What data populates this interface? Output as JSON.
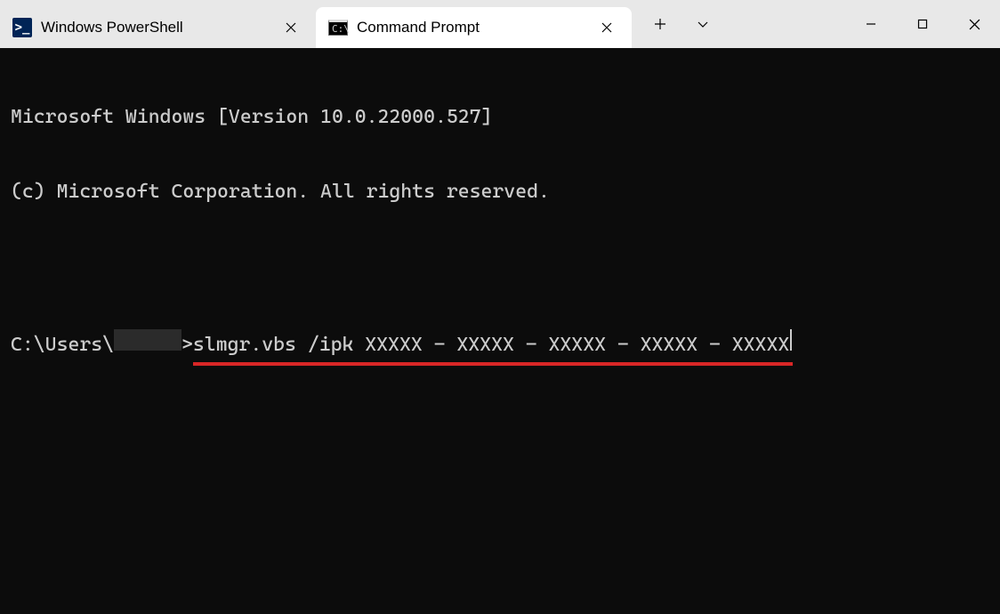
{
  "tabs": [
    {
      "title": "Windows PowerShell",
      "icon": "powershell-icon",
      "active": false
    },
    {
      "title": "Command Prompt",
      "icon": "cmd-icon",
      "active": true
    }
  ],
  "terminal": {
    "banner_line1": "Microsoft Windows [Version 10.0.22000.527]",
    "banner_line2": "(c) Microsoft Corporation. All rights reserved.",
    "prompt_prefix": "C:\\Users\\",
    "prompt_suffix": ">",
    "command": "slmgr.vbs /ipk XXXXX - XXXXX - XXXXX - XXXXX - XXXXX"
  },
  "icons": {
    "close": "×",
    "plus": "+",
    "chevron_down": "⌄",
    "minimize": "—",
    "maximize": "▢",
    "win_close": "✕"
  }
}
